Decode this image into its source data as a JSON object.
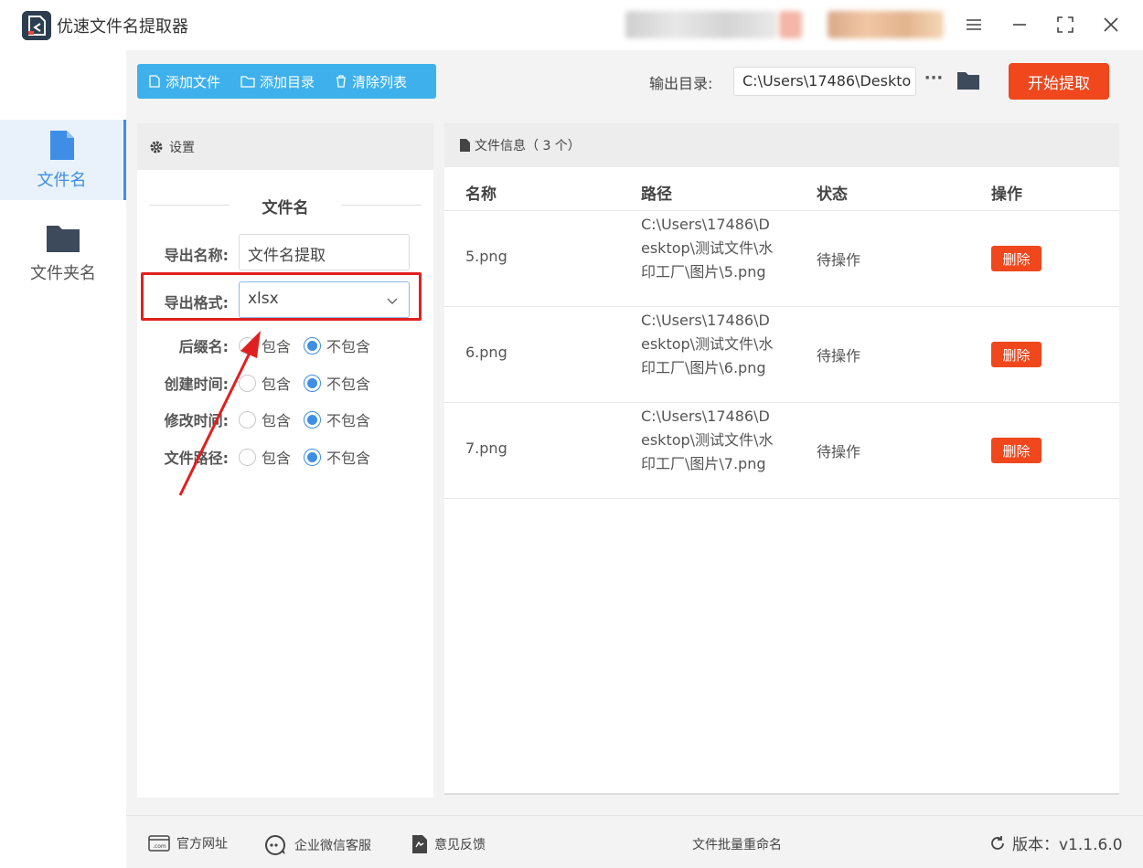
{
  "app": {
    "title": "优速文件名提取器"
  },
  "rail": {
    "items": [
      {
        "label": "文件名",
        "icon": "file-icon",
        "active": true
      },
      {
        "label": "文件夹名",
        "icon": "folder-icon",
        "active": false
      }
    ]
  },
  "toolbar": {
    "add_file": "添加文件",
    "add_dir": "添加目录",
    "clear_list": "清除列表",
    "output_label": "输出目录:",
    "output_path": "C:\\Users\\17486\\Deskto",
    "more": "···",
    "start": "开始提取"
  },
  "settings": {
    "header": "设置",
    "section_title": "文件名",
    "name_label": "导出名称:",
    "name_value": "文件名提取",
    "format_label": "导出格式:",
    "format_value": "xlsx",
    "options": [
      {
        "label": "后缀名:",
        "include": "包含",
        "exclude": "不包含",
        "selected": "exclude"
      },
      {
        "label": "创建时间:",
        "include": "包含",
        "exclude": "不包含",
        "selected": "exclude"
      },
      {
        "label": "修改时间:",
        "include": "包含",
        "exclude": "不包含",
        "selected": "exclude"
      },
      {
        "label": "文件路径:",
        "include": "包含",
        "exclude": "不包含",
        "selected": "exclude"
      }
    ]
  },
  "files": {
    "header": "文件信息（ 3 个）",
    "columns": [
      "名称",
      "路径",
      "状态",
      "操作"
    ],
    "rows": [
      {
        "name": "5.png",
        "path": "C:\\Users\\17486\\Desktop\\测试文件\\水印工厂\\图片\\5.png",
        "status": "待操作",
        "action": "删除"
      },
      {
        "name": "6.png",
        "path": "C:\\Users\\17486\\Desktop\\测试文件\\水印工厂\\图片\\6.png",
        "status": "待操作",
        "action": "删除"
      },
      {
        "name": "7.png",
        "path": "C:\\Users\\17486\\Desktop\\测试文件\\水印工厂\\图片\\7.png",
        "status": "待操作",
        "action": "删除"
      }
    ]
  },
  "footer": {
    "website": "官方网址",
    "support": "企业微信客服",
    "feedback": "意见反馈",
    "center": "文件批量重命名",
    "version": "版本：v1.1.6.0"
  },
  "colors": {
    "accent_blue": "#3eb1ec",
    "primary_blue": "#3f8ee6",
    "danger": "#f0471c",
    "highlight": "#e02020"
  }
}
